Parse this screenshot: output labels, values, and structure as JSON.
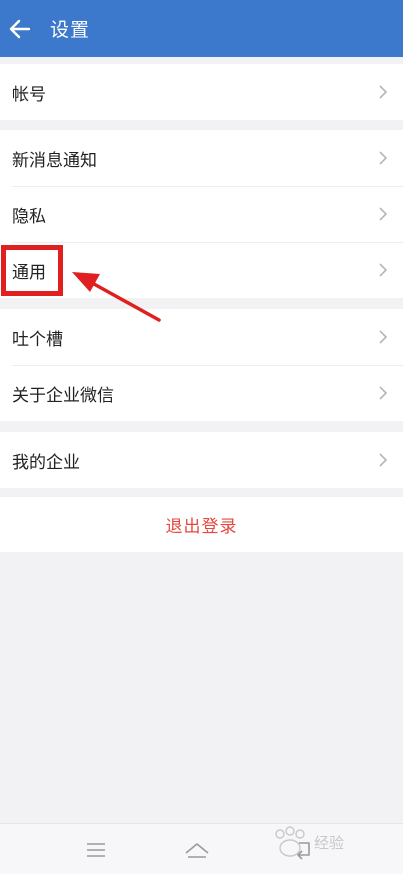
{
  "header": {
    "title": "设置",
    "back_icon": "arrow-left-icon",
    "bg_color": "#3c79cc"
  },
  "groups": [
    {
      "items": [
        {
          "label": "帐号"
        }
      ]
    },
    {
      "items": [
        {
          "label": "新消息通知"
        },
        {
          "label": "隐私"
        },
        {
          "label": "通用"
        }
      ]
    },
    {
      "items": [
        {
          "label": "吐个槽"
        },
        {
          "label": "关于企业微信"
        }
      ]
    },
    {
      "items": [
        {
          "label": "我的企业"
        }
      ]
    }
  ],
  "logout": {
    "label": "退出登录",
    "color": "#e5483f"
  },
  "annotation": {
    "highlight_color": "#e02020",
    "highlighted_item": "通用"
  },
  "navbar": {
    "buttons": [
      {
        "icon": "menu-icon"
      },
      {
        "icon": "home-icon"
      },
      {
        "icon": "back-icon"
      }
    ]
  },
  "watermark": {
    "text": "经验"
  }
}
